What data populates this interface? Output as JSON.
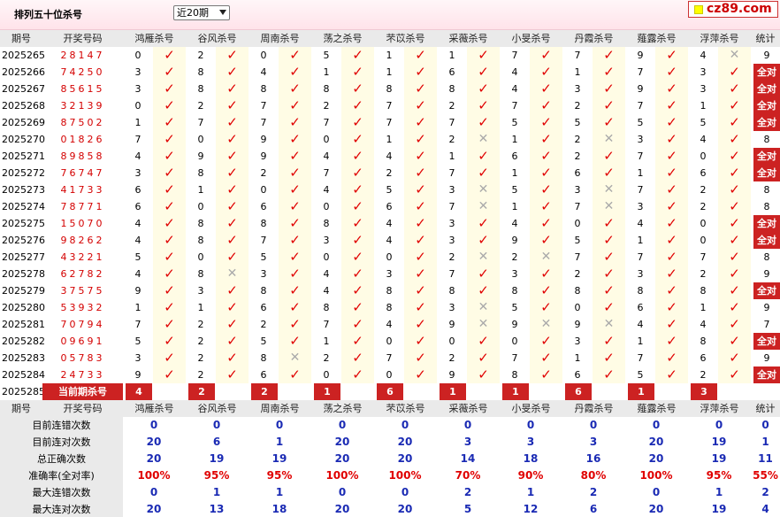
{
  "header": {
    "title": "排列五十位杀号",
    "period_select": "近20期",
    "logo": "cz89.com"
  },
  "columns": {
    "issue": "期号",
    "numbers": "开奖号码",
    "killers": [
      "鸿雁杀号",
      "谷风杀号",
      "周南杀号",
      "荡之杀号",
      "芣苡杀号",
      "采薇杀号",
      "小旻杀号",
      "丹霞杀号",
      "薤露杀号",
      "浮萍杀号"
    ],
    "stats": "统计"
  },
  "rows": [
    {
      "issue": "2025265",
      "nums": "28147",
      "k": [
        [
          0,
          1
        ],
        [
          2,
          1
        ],
        [
          0,
          1
        ],
        [
          5,
          1
        ],
        [
          1,
          1
        ],
        [
          1,
          1
        ],
        [
          7,
          1
        ],
        [
          7,
          1
        ],
        [
          9,
          1
        ],
        [
          4,
          0
        ]
      ],
      "stat": "9"
    },
    {
      "issue": "2025266",
      "nums": "74250",
      "k": [
        [
          3,
          1
        ],
        [
          8,
          1
        ],
        [
          4,
          1
        ],
        [
          1,
          1
        ],
        [
          1,
          1
        ],
        [
          6,
          1
        ],
        [
          4,
          1
        ],
        [
          1,
          1
        ],
        [
          7,
          1
        ],
        [
          3,
          1
        ]
      ],
      "stat": "全对"
    },
    {
      "issue": "2025267",
      "nums": "85615",
      "k": [
        [
          3,
          1
        ],
        [
          8,
          1
        ],
        [
          8,
          1
        ],
        [
          8,
          1
        ],
        [
          8,
          1
        ],
        [
          8,
          1
        ],
        [
          4,
          1
        ],
        [
          3,
          1
        ],
        [
          9,
          1
        ],
        [
          3,
          1
        ]
      ],
      "stat": "全对"
    },
    {
      "issue": "2025268",
      "nums": "32139",
      "k": [
        [
          0,
          1
        ],
        [
          2,
          1
        ],
        [
          7,
          1
        ],
        [
          2,
          1
        ],
        [
          7,
          1
        ],
        [
          2,
          1
        ],
        [
          7,
          1
        ],
        [
          2,
          1
        ],
        [
          7,
          1
        ],
        [
          1,
          1
        ]
      ],
      "stat": "全对"
    },
    {
      "issue": "2025269",
      "nums": "87502",
      "k": [
        [
          1,
          1
        ],
        [
          7,
          1
        ],
        [
          7,
          1
        ],
        [
          7,
          1
        ],
        [
          7,
          1
        ],
        [
          7,
          1
        ],
        [
          5,
          1
        ],
        [
          5,
          1
        ],
        [
          5,
          1
        ],
        [
          5,
          1
        ]
      ],
      "stat": "全对"
    },
    {
      "issue": "2025270",
      "nums": "01826",
      "k": [
        [
          7,
          1
        ],
        [
          0,
          1
        ],
        [
          9,
          1
        ],
        [
          0,
          1
        ],
        [
          1,
          1
        ],
        [
          2,
          0
        ],
        [
          1,
          1
        ],
        [
          2,
          0
        ],
        [
          3,
          1
        ],
        [
          4,
          1
        ]
      ],
      "stat": "8"
    },
    {
      "issue": "2025271",
      "nums": "89858",
      "k": [
        [
          4,
          1
        ],
        [
          9,
          1
        ],
        [
          9,
          1
        ],
        [
          4,
          1
        ],
        [
          4,
          1
        ],
        [
          1,
          1
        ],
        [
          6,
          1
        ],
        [
          2,
          1
        ],
        [
          7,
          1
        ],
        [
          0,
          1
        ]
      ],
      "stat": "全对"
    },
    {
      "issue": "2025272",
      "nums": "76747",
      "k": [
        [
          3,
          1
        ],
        [
          8,
          1
        ],
        [
          2,
          1
        ],
        [
          7,
          1
        ],
        [
          2,
          1
        ],
        [
          7,
          1
        ],
        [
          1,
          1
        ],
        [
          6,
          1
        ],
        [
          1,
          1
        ],
        [
          6,
          1
        ]
      ],
      "stat": "全对"
    },
    {
      "issue": "2025273",
      "nums": "41733",
      "k": [
        [
          6,
          1
        ],
        [
          1,
          1
        ],
        [
          0,
          1
        ],
        [
          4,
          1
        ],
        [
          5,
          1
        ],
        [
          3,
          0
        ],
        [
          5,
          1
        ],
        [
          3,
          0
        ],
        [
          7,
          1
        ],
        [
          2,
          1
        ]
      ],
      "stat": "8"
    },
    {
      "issue": "2025274",
      "nums": "78771",
      "k": [
        [
          6,
          1
        ],
        [
          0,
          1
        ],
        [
          6,
          1
        ],
        [
          0,
          1
        ],
        [
          6,
          1
        ],
        [
          7,
          0
        ],
        [
          1,
          1
        ],
        [
          7,
          0
        ],
        [
          3,
          1
        ],
        [
          2,
          1
        ]
      ],
      "stat": "8"
    },
    {
      "issue": "2025275",
      "nums": "15070",
      "k": [
        [
          4,
          1
        ],
        [
          8,
          1
        ],
        [
          8,
          1
        ],
        [
          8,
          1
        ],
        [
          4,
          1
        ],
        [
          3,
          1
        ],
        [
          4,
          1
        ],
        [
          0,
          1
        ],
        [
          4,
          1
        ],
        [
          0,
          1
        ]
      ],
      "stat": "全对"
    },
    {
      "issue": "2025276",
      "nums": "98262",
      "k": [
        [
          4,
          1
        ],
        [
          8,
          1
        ],
        [
          7,
          1
        ],
        [
          3,
          1
        ],
        [
          4,
          1
        ],
        [
          3,
          1
        ],
        [
          9,
          1
        ],
        [
          5,
          1
        ],
        [
          1,
          1
        ],
        [
          0,
          1
        ]
      ],
      "stat": "全对"
    },
    {
      "issue": "2025277",
      "nums": "43221",
      "k": [
        [
          5,
          1
        ],
        [
          0,
          1
        ],
        [
          5,
          1
        ],
        [
          0,
          1
        ],
        [
          0,
          1
        ],
        [
          2,
          0
        ],
        [
          2,
          0
        ],
        [
          7,
          1
        ],
        [
          7,
          1
        ],
        [
          7,
          1
        ]
      ],
      "stat": "8"
    },
    {
      "issue": "2025278",
      "nums": "62782",
      "k": [
        [
          4,
          1
        ],
        [
          8,
          0
        ],
        [
          3,
          1
        ],
        [
          4,
          1
        ],
        [
          3,
          1
        ],
        [
          7,
          1
        ],
        [
          3,
          1
        ],
        [
          2,
          1
        ],
        [
          3,
          1
        ],
        [
          2,
          1
        ]
      ],
      "stat": "9"
    },
    {
      "issue": "2025279",
      "nums": "37575",
      "k": [
        [
          9,
          1
        ],
        [
          3,
          1
        ],
        [
          8,
          1
        ],
        [
          4,
          1
        ],
        [
          8,
          1
        ],
        [
          8,
          1
        ],
        [
          8,
          1
        ],
        [
          8,
          1
        ],
        [
          8,
          1
        ],
        [
          8,
          1
        ]
      ],
      "stat": "全对"
    },
    {
      "issue": "2025280",
      "nums": "53932",
      "k": [
        [
          1,
          1
        ],
        [
          1,
          1
        ],
        [
          6,
          1
        ],
        [
          8,
          1
        ],
        [
          8,
          1
        ],
        [
          3,
          0
        ],
        [
          5,
          1
        ],
        [
          0,
          1
        ],
        [
          6,
          1
        ],
        [
          1,
          1
        ]
      ],
      "stat": "9"
    },
    {
      "issue": "2025281",
      "nums": "70794",
      "k": [
        [
          7,
          1
        ],
        [
          2,
          1
        ],
        [
          2,
          1
        ],
        [
          7,
          1
        ],
        [
          4,
          1
        ],
        [
          9,
          0
        ],
        [
          9,
          0
        ],
        [
          9,
          0
        ],
        [
          4,
          1
        ],
        [
          4,
          1
        ]
      ],
      "stat": "7"
    },
    {
      "issue": "2025282",
      "nums": "09691",
      "k": [
        [
          5,
          1
        ],
        [
          2,
          1
        ],
        [
          5,
          1
        ],
        [
          1,
          1
        ],
        [
          0,
          1
        ],
        [
          0,
          1
        ],
        [
          0,
          1
        ],
        [
          3,
          1
        ],
        [
          1,
          1
        ],
        [
          8,
          1
        ]
      ],
      "stat": "全对"
    },
    {
      "issue": "2025283",
      "nums": "05783",
      "k": [
        [
          3,
          1
        ],
        [
          2,
          1
        ],
        [
          8,
          0
        ],
        [
          2,
          1
        ],
        [
          7,
          1
        ],
        [
          2,
          1
        ],
        [
          7,
          1
        ],
        [
          1,
          1
        ],
        [
          7,
          1
        ],
        [
          6,
          1
        ]
      ],
      "stat": "9"
    },
    {
      "issue": "2025284",
      "nums": "24733",
      "k": [
        [
          9,
          1
        ],
        [
          2,
          1
        ],
        [
          6,
          1
        ],
        [
          0,
          1
        ],
        [
          0,
          1
        ],
        [
          9,
          1
        ],
        [
          8,
          1
        ],
        [
          6,
          1
        ],
        [
          5,
          1
        ],
        [
          2,
          1
        ]
      ],
      "stat": "全对"
    }
  ],
  "current": {
    "issue": "2025285",
    "label": "当前期杀号",
    "values": [
      "4",
      "2",
      "2",
      "1",
      "6",
      "1",
      "1",
      "6",
      "1",
      "3"
    ]
  },
  "stats_table": {
    "rows": [
      {
        "label": "目前连错次数",
        "values": [
          "0",
          "0",
          "0",
          "0",
          "0",
          "0",
          "0",
          "0",
          "0",
          "0",
          "0"
        ],
        "red": false
      },
      {
        "label": "目前连对次数",
        "values": [
          "20",
          "6",
          "1",
          "20",
          "20",
          "3",
          "3",
          "3",
          "20",
          "19",
          "1"
        ],
        "red": false
      },
      {
        "label": "总正确次数",
        "values": [
          "20",
          "19",
          "19",
          "20",
          "20",
          "14",
          "18",
          "16",
          "20",
          "19",
          "11"
        ],
        "red": false
      },
      {
        "label": "准确率(全对率)",
        "values": [
          "100%",
          "95%",
          "95%",
          "100%",
          "100%",
          "70%",
          "90%",
          "80%",
          "100%",
          "95%",
          "55%"
        ],
        "red": true
      },
      {
        "label": "最大连错次数",
        "values": [
          "0",
          "1",
          "1",
          "0",
          "0",
          "2",
          "1",
          "2",
          "0",
          "1",
          "2"
        ],
        "red": false
      },
      {
        "label": "最大连对次数",
        "values": [
          "20",
          "13",
          "18",
          "20",
          "20",
          "5",
          "12",
          "6",
          "20",
          "19",
          "4"
        ],
        "red": false
      }
    ]
  },
  "icons": {
    "check": "check-icon",
    "cross": "cross-icon"
  },
  "colors": {
    "accent": "#cc2222",
    "number_red": "#d40000",
    "stat_blue": "#1a2ab4",
    "header_grey": "#eaeaea"
  }
}
